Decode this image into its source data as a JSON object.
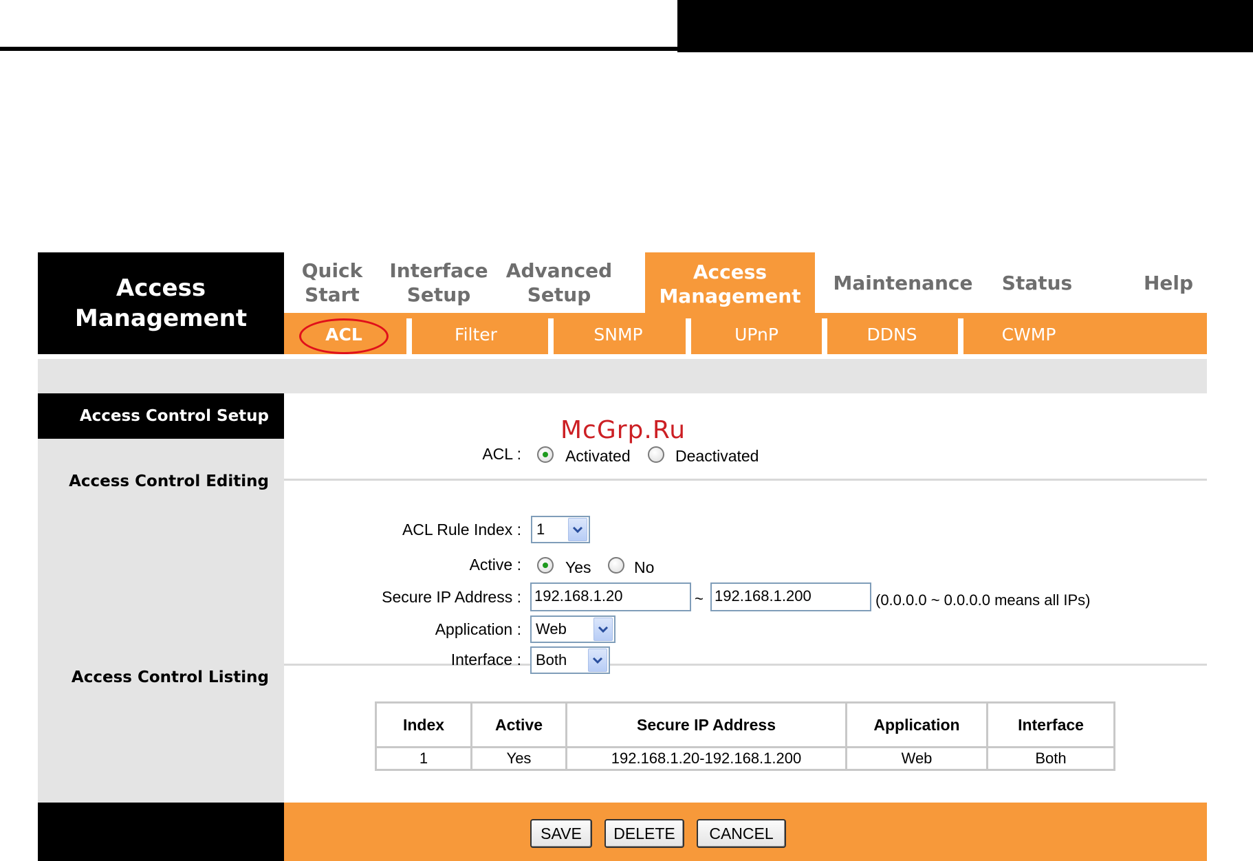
{
  "brand": {
    "title": "Access\nManagement"
  },
  "tabs": [
    {
      "label": "Quick\nStart"
    },
    {
      "label": "Interface\nSetup"
    },
    {
      "label": "Advanced\nSetup"
    },
    {
      "label": "Access\nManagement"
    },
    {
      "label": "Maintenance"
    },
    {
      "label": "Status"
    },
    {
      "label": "Help"
    }
  ],
  "subtabs": [
    {
      "label": "ACL"
    },
    {
      "label": "Filter"
    },
    {
      "label": "SNMP"
    },
    {
      "label": "UPnP"
    },
    {
      "label": "DDNS"
    },
    {
      "label": "CWMP"
    }
  ],
  "sidebar": {
    "header": "Access Control Setup",
    "editing": "Access Control Editing",
    "listing": "Access Control Listing"
  },
  "watermark": "McGrp.Ru",
  "form": {
    "acl_label": "ACL :",
    "acl_activated": "Activated",
    "acl_deactivated": "Deactivated",
    "rule_index_label": "ACL Rule Index :",
    "rule_index_value": "1",
    "active_label": "Active :",
    "active_yes": "Yes",
    "active_no": "No",
    "secure_ip_label": "Secure IP Address :",
    "ip_start": "192.168.1.20",
    "ip_sep": "~",
    "ip_end": "192.168.1.200",
    "ip_hint": "(0.0.0.0 ~ 0.0.0.0 means all IPs)",
    "application_label": "Application :",
    "application_value": "Web",
    "interface_label": "Interface :",
    "interface_value": "Both"
  },
  "table": {
    "headers": [
      "Index",
      "Active",
      "Secure IP Address",
      "Application",
      "Interface"
    ],
    "rows": [
      [
        "1",
        "Yes",
        "192.168.1.20-192.168.1.200",
        "Web",
        "Both"
      ]
    ]
  },
  "buttons": {
    "save": "SAVE",
    "delete": "DELETE",
    "cancel": "CANCEL"
  },
  "colors": {
    "accent": "#f7993a",
    "panel_gray": "#e4e4e4",
    "watermark_red": "#cc1f24"
  }
}
